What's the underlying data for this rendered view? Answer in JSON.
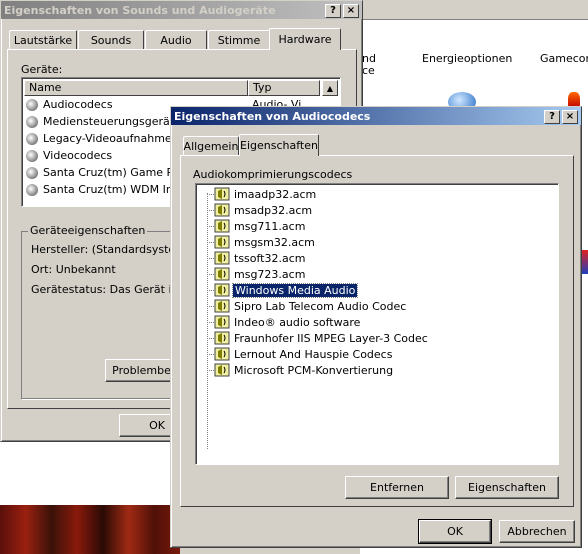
{
  "background_window": {
    "labels": [
      "nd",
      "ce",
      "Energieoptionen",
      "Gamecont"
    ]
  },
  "sound_dialog": {
    "title": "Eigenschaften von Sounds und Audiogeräte",
    "help": "?",
    "close": "×",
    "tabs": [
      "Lautstärke",
      "Sounds",
      "Audio",
      "Stimme",
      "Hardware"
    ],
    "selected_tab": "Hardware",
    "devices_label": "Geräte:",
    "columns": [
      "Name",
      "Typ"
    ],
    "devices": [
      {
        "name": "Audiocodecs",
        "type": "Audio- Vi"
      },
      {
        "name": "Mediensteuerungsgerät",
        "type": ""
      },
      {
        "name": "Legacy-Videoaufnahmeger",
        "type": ""
      },
      {
        "name": "Videocodecs",
        "type": ""
      },
      {
        "name": "Santa Cruz(tm) Game Port",
        "type": ""
      },
      {
        "name": "Santa Cruz(tm) WDM Inter",
        "type": ""
      }
    ],
    "properties_group": "Geräteeigenschaften",
    "manufacturer": "Hersteller: (Standardsystemg",
    "location": "Ort: Unbekannt",
    "status": "Gerätestatus: Das Gerät ist b",
    "troubleshoot_button": "Problembeh",
    "ok_button": "OK"
  },
  "codec_dialog": {
    "title": "Eigenschaften von Audiocodecs",
    "help": "?",
    "close": "×",
    "tabs": [
      "Allgemein",
      "Eigenschaften"
    ],
    "selected_tab": "Eigenschaften",
    "group_label": "Audiokomprimierungscodecs",
    "codecs": [
      "imaadp32.acm",
      "msadp32.acm",
      "msg711.acm",
      "msgsm32.acm",
      "tssoft32.acm",
      "msg723.acm",
      "Windows Media Audio",
      "Sipro Lab Telecom Audio Codec",
      "Indeo® audio software",
      "Fraunhofer IIS MPEG Layer-3 Codec",
      "Lernout And Hauspie Codecs",
      "Microsoft PCM-Konvertierung"
    ],
    "selected_codec": "Windows Media Audio",
    "remove_button": "Entfernen",
    "properties_button": "Eigenschaften",
    "ok_button": "OK",
    "cancel_button": "Abbrechen"
  }
}
